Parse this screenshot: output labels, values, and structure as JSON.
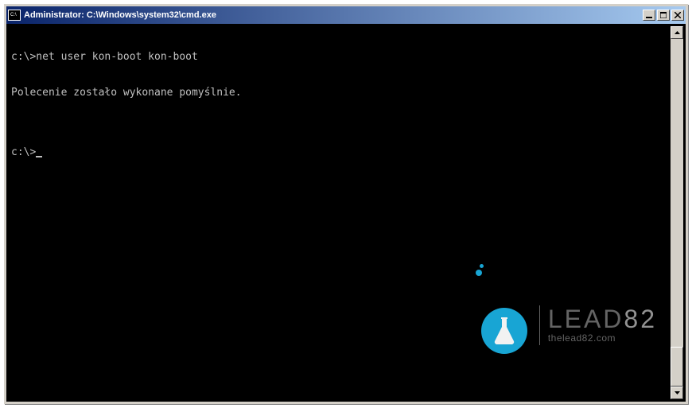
{
  "window": {
    "title": "Administrator: C:\\Windows\\system32\\cmd.exe"
  },
  "console": {
    "lines": [
      "c:\\>net user kon-boot kon-boot",
      "Polecenie zostało wykonane pomyślnie.",
      "",
      "c:\\>"
    ]
  },
  "watermark": {
    "brand_prefix": "LEAD",
    "brand_suffix": "82",
    "url": "thelead82.com"
  }
}
